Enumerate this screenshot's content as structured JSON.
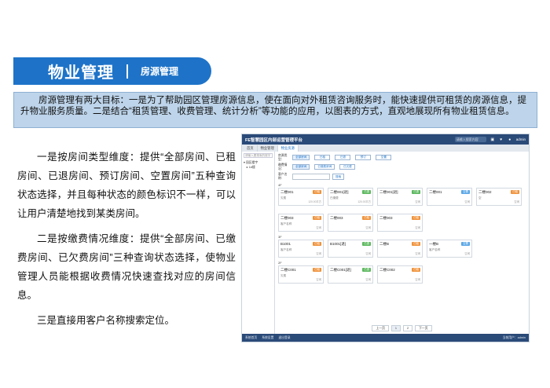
{
  "header": {
    "title": "物业管理",
    "subtitle": "房源管理"
  },
  "intro": "房源管理有两大目标：一是为了帮助园区管理房源信息，使在面向对外租赁咨询服务时，能快速提供可租赁的房源信息，提升物业服务质量。二是结合“租赁管理、收费管理、统计分析”等功能的应用，以图表的方式，直观地展现所有物业租赁信息。",
  "paragraphs": [
    "一是按房间类型维度：提供“全部房间、已租房间、已退房间、预订房间、空置房间”五种查询状态选择，并且每种状态的颜色标识不一样，可以让用户清楚地找到某类房间。",
    "二是按缴费情况维度：提供“全部房间、已缴费房间、已欠费房间”三种查询状态选择，使物业管理人员能根据收费情况快速查找对应的房间信息。",
    "三是直接用客户名称搜索定位。"
  ],
  "app": {
    "title": "FE智慧园区内部运营管理平台",
    "search_placeholder": "请输入搜索内容",
    "user": "admin",
    "tabs": [
      "首页",
      "物业管理",
      "物业房源"
    ],
    "sidebar_search": "请输入要搜索的楼宇",
    "tree": [
      "▾ 园区楼宇",
      "　▸ 1#楼"
    ],
    "filters": {
      "type_label": "房源类型：",
      "type_options": [
        "全部房间",
        "已租",
        "已退",
        "预订",
        "空置"
      ],
      "fee_label": "缴费情况：",
      "fee_options": [
        "全部房间",
        "已缴费房间",
        "已欠费"
      ],
      "customer_label": "客户名称：",
      "search_btn": "搜索"
    },
    "floors": [
      {
        "label": "4F",
        "rooms": [
          {
            "name": "二楼001",
            "tag": "已租",
            "color": "orange",
            "status": "欠费",
            "area": "120.00平方"
          },
          {
            "name": "二楼001[退]",
            "tag": "已退",
            "color": "green",
            "status": "已缴费",
            "area": "120.00平方"
          },
          {
            "name": "二楼001[退]",
            "tag": "已退",
            "color": "green",
            "status": "",
            "area": "空闲"
          },
          {
            "name": "二楼001",
            "tag": "空置",
            "color": "blue",
            "status": "",
            "area": "空闲"
          },
          {
            "name": "二楼002",
            "tag": "已租",
            "color": "orange",
            "status": "空",
            "area": "空闲"
          }
        ]
      },
      {
        "label": "",
        "rooms": [
          {
            "name": "二楼003",
            "tag": "已租",
            "color": "orange",
            "status": "客户名称",
            "area": "空闲"
          },
          {
            "name": "二楼003",
            "tag": "已租",
            "color": "orange",
            "status": "",
            "area": "空闲"
          },
          {
            "name": "二楼003",
            "tag": "已租",
            "color": "orange",
            "status": "",
            "area": "空闲"
          }
        ]
      },
      {
        "label": "3F",
        "rooms": [
          {
            "name": "B1001",
            "tag": "已租",
            "color": "orange",
            "status": "客户名称",
            "area": "空闲"
          },
          {
            "name": "B1001[退]",
            "tag": "已退",
            "color": "green",
            "status": "",
            "area": "空闲"
          },
          {
            "name": "二楼B",
            "tag": "已租",
            "color": "orange",
            "status": "",
            "area": "空闲"
          },
          {
            "name": "一楼B",
            "tag": "空置",
            "color": "blue",
            "status": "客户名称",
            "area": "空闲"
          }
        ]
      },
      {
        "label": "2F",
        "rooms": [
          {
            "name": "二楼C001",
            "tag": "已租",
            "color": "orange",
            "status": "欠费",
            "area": "空闲"
          },
          {
            "name": "二楼C001[退]",
            "tag": "已退",
            "color": "green",
            "status": "",
            "area": "空闲"
          },
          {
            "name": "二楼C002",
            "tag": "已租",
            "color": "orange",
            "status": "",
            "area": "空闲"
          }
        ]
      }
    ],
    "pager": [
      "上一页",
      "1",
      "2",
      "下一页"
    ],
    "status": [
      "系统首页",
      "系统设置",
      "退出登录"
    ],
    "status_right": "当前用户：admin"
  },
  "colors": {
    "accent": "#1e73c8",
    "intro_bg": "#bdd4ea",
    "dark_bar": "#2a4a78"
  }
}
